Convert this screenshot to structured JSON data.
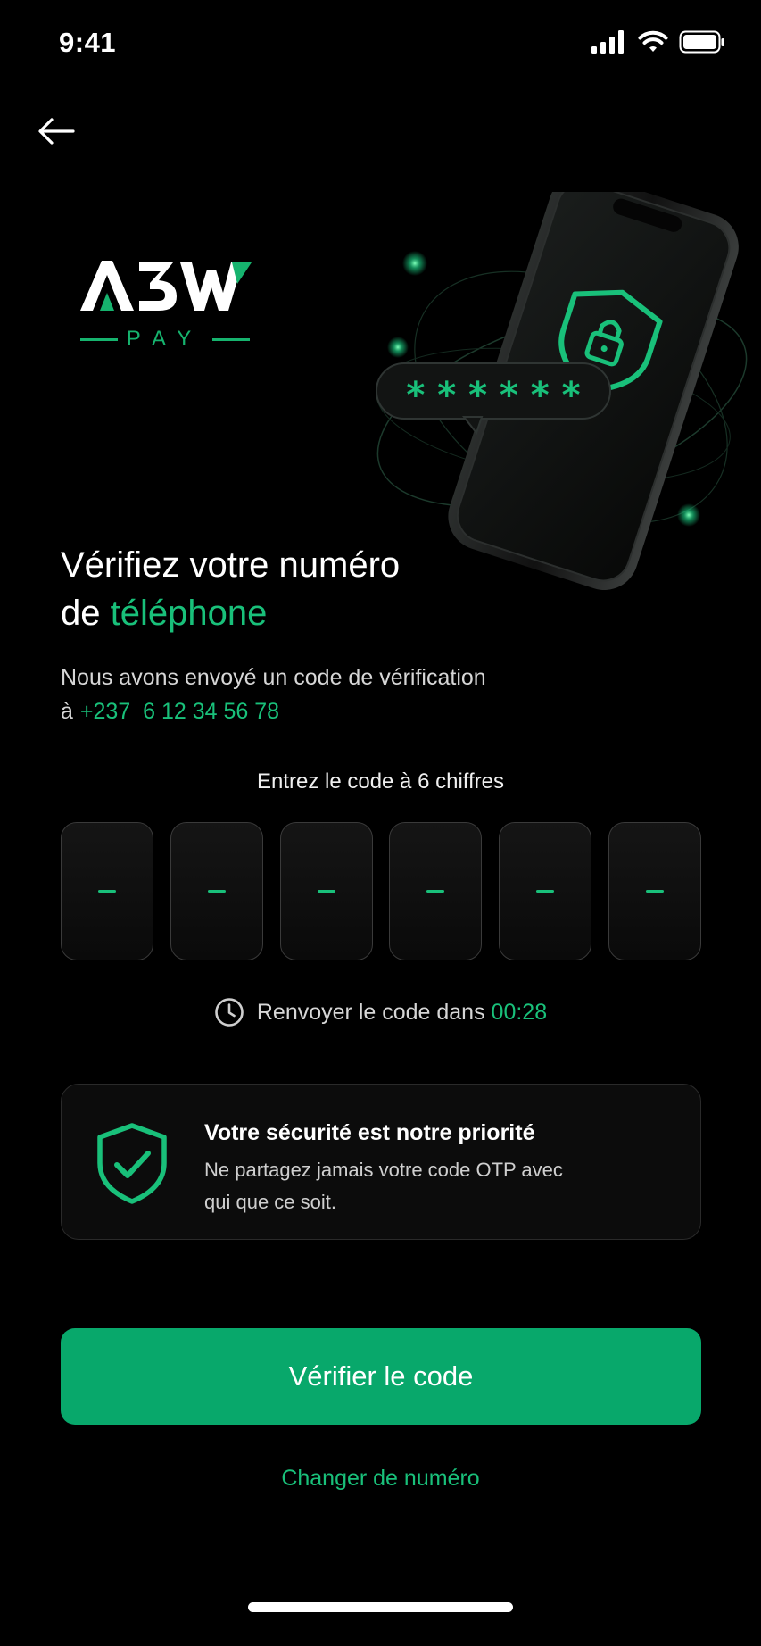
{
  "status_bar": {
    "time": "9:41"
  },
  "logo": {
    "word": "A3W",
    "sub": "PAY"
  },
  "hero": {
    "masked_code": "* * * * * *"
  },
  "title": {
    "line1": "Vérifiez votre numéro",
    "line2_prefix": "de ",
    "line2_accent": "téléphone"
  },
  "subtitle": {
    "text": "Nous avons envoyé un code de vérification",
    "to_prefix": "à",
    "phone": "+237  6 12 34 56 78"
  },
  "otp": {
    "label": "Entrez le code à 6 chiffres",
    "slots": [
      "",
      "",
      "",
      "",
      "",
      ""
    ]
  },
  "resend": {
    "text": "Renvoyer le code dans",
    "timer": "00:28"
  },
  "security": {
    "title": "Votre sécurité est notre priorité",
    "body": "Ne partagez jamais votre code OTP avec qui que ce soit."
  },
  "actions": {
    "verify_label": "Vérifier le code",
    "change_label": "Changer de numéro"
  },
  "colors": {
    "accent": "#19c07a",
    "button": "#08a86b",
    "background": "#000000"
  },
  "icons": {
    "back": "arrow-left-icon",
    "clock": "clock-icon",
    "shield_check": "shield-check-icon",
    "shield_lock": "shield-lock-icon"
  }
}
